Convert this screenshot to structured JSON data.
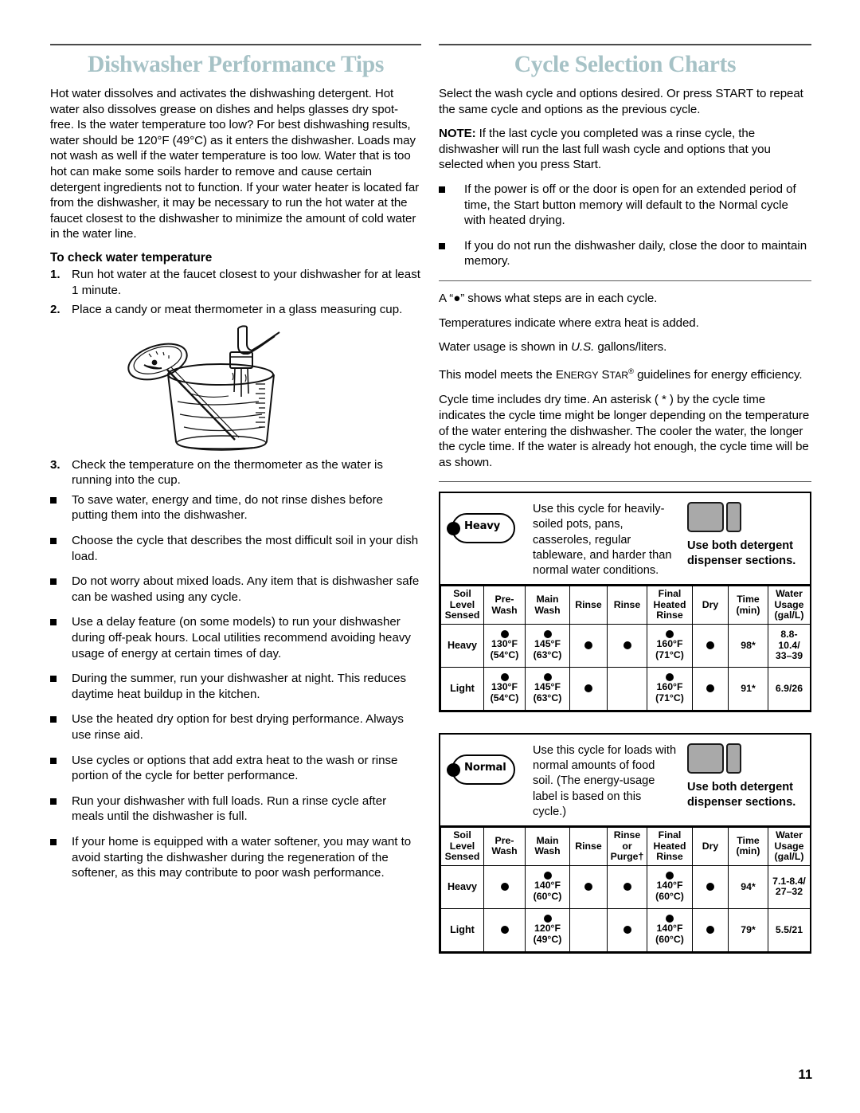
{
  "page": {
    "number": "11"
  },
  "left": {
    "title": "Dishwasher Performance Tips",
    "intro": "Hot water dissolves and activates the dishwashing detergent. Hot water also dissolves grease on dishes and helps glasses dry spot-free. Is the water temperature too low? For best dishwashing results, water should be 120°F (49°C) as it enters the dishwasher. Loads may not wash as well if the water temperature is too low. Water that is too hot can make some soils harder to remove and cause certain detergent ingredients not to function. If your water heater is located far from the dishwasher, it may be necessary to run the hot water at the faucet closest to the dishwasher to minimize the amount of cold water in the water line.",
    "subhead": "To check water temperature",
    "steps": [
      {
        "num": "1.",
        "text": "Run hot water at the faucet closest to your dishwasher for at least 1 minute."
      },
      {
        "num": "2.",
        "text": "Place a candy or meat thermometer in a glass measuring cup."
      }
    ],
    "step3": {
      "num": "3.",
      "text": "Check the temperature on the thermometer as the water is running into the cup."
    },
    "illustration_name": "measuring-cup-thermometer-faucet",
    "bullets": [
      "To save water, energy and time, do not rinse dishes before putting them into the dishwasher.",
      "Choose the cycle that describes the most difficult soil in your dish load.",
      "Do not worry about mixed loads. Any item that is dishwasher safe can be washed using any cycle.",
      "Use a delay feature (on some models) to run your dishwasher during off-peak hours. Local utilities recommend avoiding heavy usage of energy at certain times of day.",
      "During the summer, run your dishwasher at night. This reduces daytime heat buildup in the kitchen.",
      "Use the heated dry option for best drying performance. Always use rinse aid.",
      "Use cycles or options that add extra heat to the wash or rinse portion of the cycle for better performance.",
      "Run your dishwasher with full loads. Run a rinse cycle after meals until the dishwasher is full.",
      "If your home is equipped with a water softener, you may want to avoid starting the dishwasher during the regeneration of the softener, as this may contribute to poor wash performance."
    ]
  },
  "right": {
    "title": "Cycle Selection Charts",
    "intro": "Select the wash cycle and options desired. Or press START to repeat the same cycle and options as the previous cycle.",
    "note_label": "NOTE:",
    "note_text": " If the last cycle you completed was a rinse cycle, the dishwasher will run the last full wash cycle and options that you selected when you press Start.",
    "bullets": [
      "If the power is off or the door is open for an extended period of time, the Start button memory will default to the Normal cycle with heated drying.",
      "If you do not run the dishwasher daily, close the door to maintain memory."
    ],
    "legend": [
      "A “●” shows what steps are in each cycle.",
      "Temperatures indicate where extra heat is added.",
      "Water usage is shown in U.S. gallons/liters.",
      "This model meets the ENERGY STAR® guidelines for energy efficiency.",
      "Cycle time includes dry time. An asterisk ( * ) by the cycle time indicates the cycle time might be longer depending on the temperature of the water entering the dishwasher. The cooler the water, the longer the cycle time. If the water is already hot enough, the cycle time will be as shown."
    ],
    "legend_water_prefix": "Water usage is shown in ",
    "legend_water_italic": "U.S.",
    "legend_water_suffix": " gallons/liters.",
    "legend_energy_prefix": "This model meets the ",
    "legend_energy_sc1": "E",
    "legend_energy_sc1b": "NERGY",
    "legend_energy_sc2": "S",
    "legend_energy_sc2b": "TAR",
    "legend_energy_sup": "®",
    "legend_energy_suffix": " guidelines for energy efficiency."
  },
  "chart_data": [
    {
      "type": "table",
      "title": "Heavy",
      "badge_label": "Heavy",
      "description": "Use this cycle for heavily-soiled pots, pans, casseroles, regular tableware, and harder than normal water conditions.",
      "dispenser_note": "Use both detergent dispenser sections.",
      "columns": [
        "Soil Level Sensed",
        "Pre- Wash",
        "Main Wash",
        "Rinse",
        "Rinse",
        "Final Heated Rinse",
        "Dry",
        "Time (min)",
        "Water Usage (gal/L)"
      ],
      "column_lines": [
        [
          "Soil",
          "Level",
          "Sensed"
        ],
        [
          "Pre-",
          "Wash"
        ],
        [
          "Main",
          "Wash"
        ],
        [
          "Rinse"
        ],
        [
          "Rinse"
        ],
        [
          "Final",
          "Heated",
          "Rinse"
        ],
        [
          "Dry"
        ],
        [
          "Time",
          "(min)"
        ],
        [
          "Water",
          "Usage",
          "(gal/L)"
        ]
      ],
      "rows": [
        {
          "level": "Heavy",
          "cells": [
            {
              "dot": true,
              "temp_f": "130°F",
              "temp_c": "(54°C)"
            },
            {
              "dot": true,
              "temp_f": "145°F",
              "temp_c": "(63°C)"
            },
            {
              "dot": true
            },
            {
              "dot": true
            },
            {
              "dot": true,
              "temp_f": "160°F",
              "temp_c": "(71°C)"
            },
            {
              "dot": true
            },
            {
              "text": "98*"
            },
            {
              "lines": [
                "8.8-",
                "10.4/",
                "33–39"
              ]
            }
          ]
        },
        {
          "level": "Light",
          "cells": [
            {
              "dot": true,
              "temp_f": "130°F",
              "temp_c": "(54°C)"
            },
            {
              "dot": true,
              "temp_f": "145°F",
              "temp_c": "(63°C)"
            },
            {
              "dot": true
            },
            {},
            {
              "dot": true,
              "temp_f": "160°F",
              "temp_c": "(71°C)"
            },
            {
              "dot": true
            },
            {
              "text": "91*"
            },
            {
              "text": "6.9/26"
            }
          ]
        }
      ]
    },
    {
      "type": "table",
      "title": "Normal",
      "badge_label": "Normal",
      "description": "Use this cycle for loads with normal amounts of food soil. (The energy-usage label is based on this cycle.)",
      "dispenser_note": "Use both detergent dispenser sections.",
      "columns": [
        "Soil Level Sensed",
        "Pre- Wash",
        "Main Wash",
        "Rinse",
        "Rinse or Purge†",
        "Final Heated Rinse",
        "Dry",
        "Time (min)",
        "Water Usage (gal/L)"
      ],
      "column_lines": [
        [
          "Soil",
          "Level",
          "Sensed"
        ],
        [
          "Pre-",
          "Wash"
        ],
        [
          "Main",
          "Wash"
        ],
        [
          "Rinse"
        ],
        [
          "Rinse",
          "or",
          "Purge†"
        ],
        [
          "Final",
          "Heated",
          "Rinse"
        ],
        [
          "Dry"
        ],
        [
          "Time",
          "(min)"
        ],
        [
          "Water",
          "Usage",
          "(gal/L)"
        ]
      ],
      "rows": [
        {
          "level": "Heavy",
          "cells": [
            {
              "dot": true
            },
            {
              "dot": true,
              "temp_f": "140°F",
              "temp_c": "(60°C)"
            },
            {
              "dot": true
            },
            {
              "dot": true
            },
            {
              "dot": true,
              "temp_f": "140°F",
              "temp_c": "(60°C)"
            },
            {
              "dot": true
            },
            {
              "text": "94*"
            },
            {
              "lines": [
                "7.1-8.4/",
                "27–32"
              ]
            }
          ]
        },
        {
          "level": "Light",
          "cells": [
            {
              "dot": true
            },
            {
              "dot": true,
              "temp_f": "120°F",
              "temp_c": "(49°C)"
            },
            {},
            {
              "dot": true
            },
            {
              "dot": true,
              "temp_f": "140°F",
              "temp_c": "(60°C)"
            },
            {
              "dot": true
            },
            {
              "text": "79*"
            },
            {
              "text": "5.5/21"
            }
          ]
        }
      ]
    }
  ]
}
